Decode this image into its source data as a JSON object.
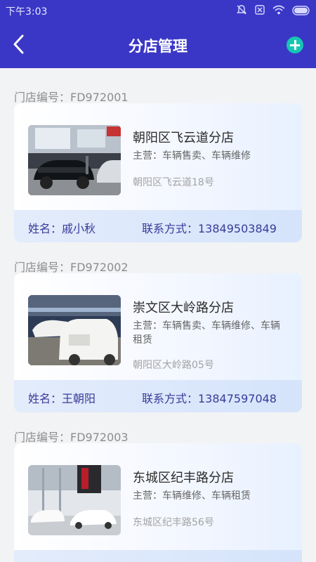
{
  "status_bar": {
    "time": "下午3:03"
  },
  "app_bar": {
    "title": "分店管理"
  },
  "stores": [
    {
      "code": "门店编号：FD972001",
      "name": "朝阳区飞云道分店",
      "business": "主营：车辆售卖、车辆维修",
      "address": "朝阳区飞云道18号",
      "manager": "姓名：戚小秋",
      "phone": "联系方式：13849503849"
    },
    {
      "code": "门店编号：FD972002",
      "name": "崇文区大岭路分店",
      "business": "主营：车辆售卖、车辆维修、车辆租赁",
      "address": "朝阳区大岭路05号",
      "manager": "姓名：王朝阳",
      "phone": "联系方式：13847597048"
    },
    {
      "code": "门店编号：FD972003",
      "name": "东城区纪丰路分店",
      "business": "主营：车辆维修、车辆租赁",
      "address": "东城区纪丰路56号",
      "manager": "",
      "phone": ""
    }
  ],
  "colors": {
    "header": "#3a37c6",
    "add_button": "#16c6b4",
    "footer_text": "#3a3a9a"
  },
  "icons": [
    "mute-icon",
    "sim-off-icon",
    "wifi-icon",
    "battery-icon",
    "back-arrow-icon",
    "add-circle-icon"
  ]
}
